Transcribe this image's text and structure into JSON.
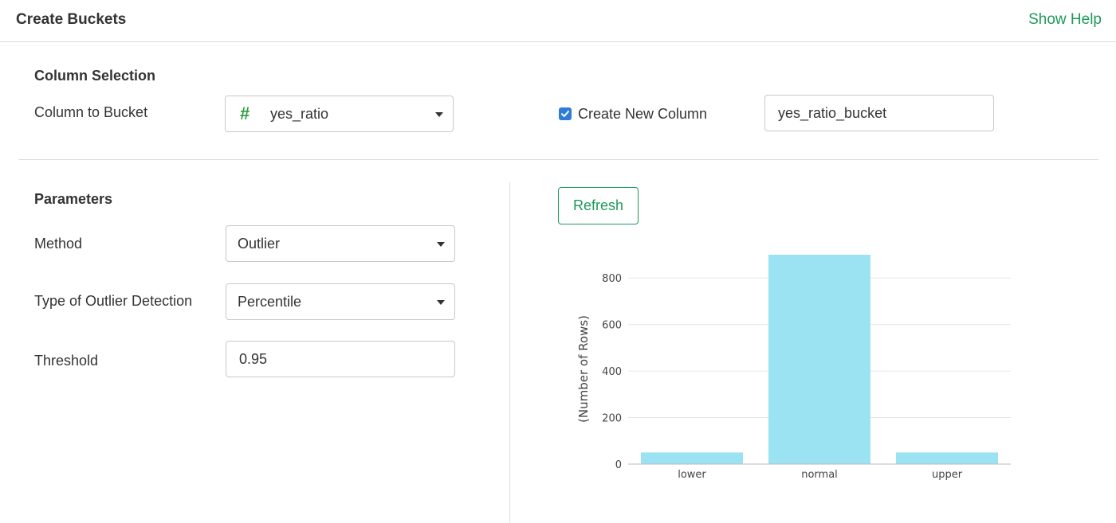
{
  "header": {
    "title": "Create Buckets",
    "help_link": "Show Help"
  },
  "column_selection": {
    "title": "Column Selection",
    "column_label": "Column to Bucket",
    "column_type_icon": "number-hash-icon",
    "column_value": "yes_ratio",
    "create_new_label": "Create New Column",
    "create_new_checked": true,
    "new_column_name": "yes_ratio_bucket"
  },
  "parameters": {
    "title": "Parameters",
    "method_label": "Method",
    "method_value": "Outlier",
    "outlier_type_label": "Type of Outlier Detection",
    "outlier_type_value": "Percentile",
    "threshold_label": "Threshold",
    "threshold_value": "0.95"
  },
  "refresh_label": "Refresh",
  "colors": {
    "accent": "#1d9a5a",
    "bar": "#9be3f3",
    "checkbox": "#2f7bd9",
    "hash_icon": "#2e9e3f"
  },
  "chart_data": {
    "type": "bar",
    "categories": [
      "lower",
      "normal",
      "upper"
    ],
    "values": [
      50,
      900,
      50
    ],
    "ylabel": "(Number of Rows)",
    "yticks": [
      0,
      200,
      400,
      600,
      800
    ],
    "ylim": [
      0,
      900
    ],
    "grid": true
  }
}
